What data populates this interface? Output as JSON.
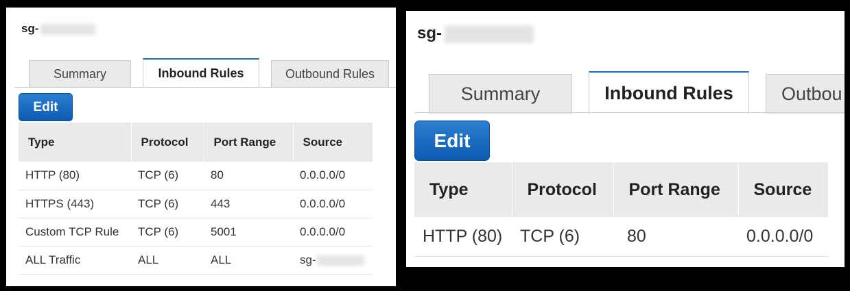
{
  "panels": {
    "left": {
      "sg_prefix": "sg-",
      "tabs": [
        "Summary",
        "Inbound Rules",
        "Outbound Rules"
      ],
      "edit_label": "Edit",
      "columns": [
        "Type",
        "Protocol",
        "Port Range",
        "Source"
      ],
      "rows": [
        {
          "type": "HTTP (80)",
          "protocol": "TCP (6)",
          "port": "80",
          "source": "0.0.0.0/0"
        },
        {
          "type": "HTTPS (443)",
          "protocol": "TCP (6)",
          "port": "443",
          "source": "0.0.0.0/0"
        },
        {
          "type": "Custom TCP Rule",
          "protocol": "TCP (6)",
          "port": "5001",
          "source": "0.0.0.0/0"
        },
        {
          "type": "ALL Traffic",
          "protocol": "ALL",
          "port": "ALL",
          "source": "sg-"
        }
      ]
    },
    "right": {
      "sg_prefix": "sg-",
      "tabs": [
        "Summary",
        "Inbound Rules",
        "Outbou"
      ],
      "edit_label": "Edit",
      "columns": [
        "Type",
        "Protocol",
        "Port Range",
        "Source"
      ],
      "rows": [
        {
          "type": "HTTP (80)",
          "protocol": "TCP (6)",
          "port": "80",
          "source": "0.0.0.0/0"
        }
      ]
    }
  },
  "colors": {
    "active_tab_accent": "#1e6fbf",
    "edit_button": "#1565c0",
    "header_bg": "#eaeaea",
    "frame_bg": "#000000"
  }
}
